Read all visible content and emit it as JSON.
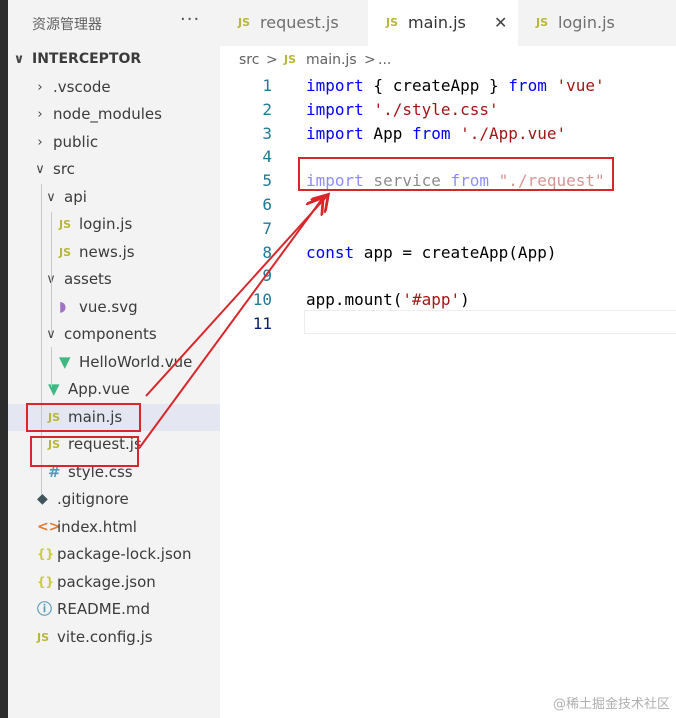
{
  "explorer": {
    "title": "资源管理器",
    "more": "···",
    "tree": [
      {
        "label": "INTERCEPTOR",
        "kind": "root",
        "depth": 0,
        "expanded": true,
        "icon": "chevron-down"
      },
      {
        "label": ".vscode",
        "kind": "folder",
        "depth": 1,
        "expanded": false
      },
      {
        "label": "node_modules",
        "kind": "folder",
        "depth": 1,
        "expanded": false
      },
      {
        "label": "public",
        "kind": "folder",
        "depth": 1,
        "expanded": false
      },
      {
        "label": "src",
        "kind": "folder",
        "depth": 1,
        "expanded": true
      },
      {
        "label": "api",
        "kind": "folder",
        "depth": 2,
        "expanded": true
      },
      {
        "label": "login.js",
        "kind": "js",
        "depth": 3
      },
      {
        "label": "news.js",
        "kind": "js",
        "depth": 3
      },
      {
        "label": "assets",
        "kind": "folder",
        "depth": 2,
        "expanded": true
      },
      {
        "label": "vue.svg",
        "kind": "svg",
        "depth": 3
      },
      {
        "label": "components",
        "kind": "folder",
        "depth": 2,
        "expanded": true
      },
      {
        "label": "HelloWorld.vue",
        "kind": "vue",
        "depth": 3
      },
      {
        "label": "App.vue",
        "kind": "vue",
        "depth": 2
      },
      {
        "label": "main.js",
        "kind": "js",
        "depth": 2,
        "selected": true
      },
      {
        "label": "request.js",
        "kind": "js",
        "depth": 2
      },
      {
        "label": "style.css",
        "kind": "css",
        "depth": 2
      },
      {
        "label": ".gitignore",
        "kind": "git",
        "depth": 1
      },
      {
        "label": "index.html",
        "kind": "html",
        "depth": 1
      },
      {
        "label": "package-lock.json",
        "kind": "json",
        "depth": 1
      },
      {
        "label": "package.json",
        "kind": "json",
        "depth": 1
      },
      {
        "label": "README.md",
        "kind": "info",
        "depth": 1
      },
      {
        "label": "vite.config.js",
        "kind": "js",
        "depth": 1
      }
    ]
  },
  "tabs": [
    {
      "label": "request.js",
      "icon": "JS",
      "active": false
    },
    {
      "label": "main.js",
      "icon": "JS",
      "active": true,
      "close": "✕"
    },
    {
      "label": "login.js",
      "icon": "JS",
      "active": false
    }
  ],
  "breadcrumb": {
    "folder": "src",
    "sep": ">",
    "icon": "JS",
    "file": "main.js",
    "sep2": ">",
    "rest": "..."
  },
  "editor": {
    "lines": [
      {
        "n": "1",
        "tokens": [
          [
            "kw",
            "import"
          ],
          [
            "fn",
            " { createApp } "
          ],
          [
            "kw",
            "from"
          ],
          [
            "fn",
            " "
          ],
          [
            "str",
            "'vue'"
          ]
        ]
      },
      {
        "n": "2",
        "tokens": [
          [
            "kw",
            "import"
          ],
          [
            "fn",
            " "
          ],
          [
            "str",
            "'./style.css'"
          ]
        ]
      },
      {
        "n": "3",
        "tokens": [
          [
            "kw",
            "import"
          ],
          [
            "fn",
            " App "
          ],
          [
            "kw",
            "from"
          ],
          [
            "fn",
            " "
          ],
          [
            "str",
            "'./App.vue'"
          ]
        ]
      },
      {
        "n": "4",
        "tokens": []
      },
      {
        "n": "5",
        "faded": true,
        "tokens": [
          [
            "kw",
            "import"
          ],
          [
            "fn",
            " service "
          ],
          [
            "kw",
            "from"
          ],
          [
            "fn",
            " "
          ],
          [
            "str",
            "\"./request\""
          ]
        ]
      },
      {
        "n": "6",
        "tokens": []
      },
      {
        "n": "7",
        "tokens": []
      },
      {
        "n": "8",
        "tokens": [
          [
            "kw",
            "const"
          ],
          [
            "fn",
            " app = createApp(App)"
          ]
        ]
      },
      {
        "n": "9",
        "tokens": []
      },
      {
        "n": "10",
        "tokens": [
          [
            "fn",
            "app.mount("
          ],
          [
            "str",
            "'#app'"
          ],
          [
            "fn",
            ")"
          ]
        ]
      },
      {
        "n": "11",
        "current": true,
        "tokens": []
      }
    ]
  },
  "watermark": "@稀土掘金技术社区",
  "colors": {
    "annotation": "#d9262b",
    "keyword": "#0000ff",
    "string": "#a31515",
    "js_icon": "#b7b73b",
    "vue_icon": "#41b883"
  }
}
